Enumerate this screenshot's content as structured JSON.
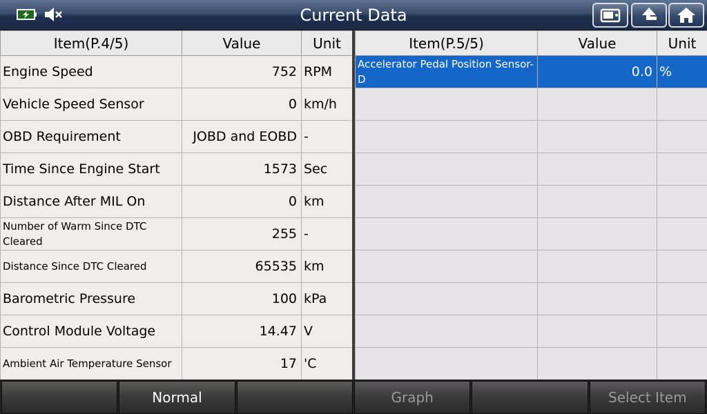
{
  "header": {
    "title": "Current Data"
  },
  "left_table": {
    "headers": {
      "item": "Item(P.4/5)",
      "value": "Value",
      "unit": "Unit"
    },
    "rows": [
      {
        "item": "Engine Speed",
        "value": "752",
        "unit": "RPM"
      },
      {
        "item": "Vehicle Speed Sensor",
        "value": "0",
        "unit": "km/h"
      },
      {
        "item": "OBD Requirement",
        "value": "JOBD and EOBD",
        "unit": "-"
      },
      {
        "item": "Time Since Engine Start",
        "value": "1573",
        "unit": "Sec"
      },
      {
        "item": "Distance After MIL On",
        "value": "0",
        "unit": "km"
      },
      {
        "item": "Number of Warm Since DTC Cleared",
        "value": "255",
        "unit": "-"
      },
      {
        "item": "Distance Since DTC Cleared",
        "value": "65535",
        "unit": "km"
      },
      {
        "item": "Barometric Pressure",
        "value": "100",
        "unit": "kPa"
      },
      {
        "item": "Control Module Voltage",
        "value": "14.47",
        "unit": "V"
      },
      {
        "item": "Ambient Air Temperature Sensor",
        "value": "17",
        "unit": "'C"
      }
    ]
  },
  "right_table": {
    "headers": {
      "item": "Item(P.5/5)",
      "value": "Value",
      "unit": "Unit"
    },
    "rows": [
      {
        "item": "Accelerator Pedal Position Sensor-D",
        "value": "0.0",
        "unit": "%"
      }
    ]
  },
  "toolbar": {
    "buttons": [
      "",
      "Normal",
      "",
      "Graph",
      "",
      "Select Item"
    ]
  },
  "colors": {
    "selected_row": "#1466c8",
    "header_bar": "#1f3150"
  },
  "icons": {
    "battery": "battery-icon",
    "mute": "mute-icon",
    "camera": "camera-icon",
    "up": "up-arrow-icon",
    "home": "home-icon"
  }
}
